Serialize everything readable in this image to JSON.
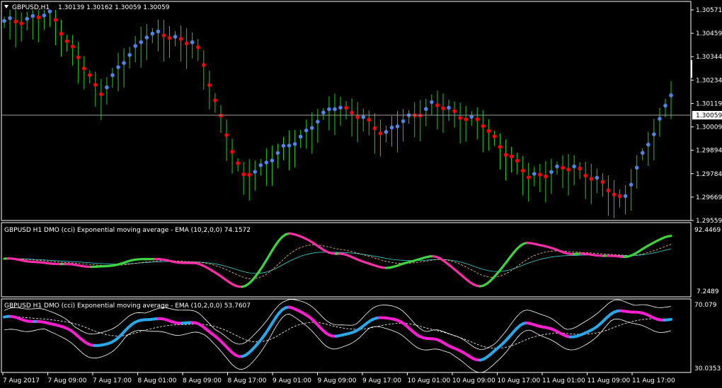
{
  "main": {
    "symbol_label": "GBPUSD,H1",
    "ohlc_label": "1.30139 1.30162 1.30059 1.30059",
    "price_ticks": [
      "1.30571",
      "1.30459",
      "1.30344",
      "1.30234",
      "1.30119",
      "1.30009",
      "1.29894",
      "1.29784",
      "1.29669",
      "1.29559"
    ],
    "current_price": "1.30059",
    "colors": {
      "bar": "#22cc22",
      "dot_up": "#4f86e6",
      "dot_down": "#ff0000",
      "price_line": "#a0a0a0"
    }
  },
  "sub1": {
    "title": "GBPUSD H1 DMO (cci) Exponential moving average - EMA (10,2,0,0) 74.1572",
    "axis_top": "92.4469",
    "axis_bottom": "7.2489",
    "colors": {
      "up": "#3fd43f",
      "down": "#ff2fa8",
      "signal": "#40d0d0",
      "ema": "#ffc080"
    }
  },
  "sub2": {
    "title": "GBPUSD H1 DMO (cci) Exponential moving average - EMA (10,2,0,0) 53.7607",
    "axis_top": "70.079",
    "axis_bottom": "30.0353",
    "colors": {
      "up": "#29a8e8",
      "down": "#ff1fcf",
      "band": "#ffffff"
    }
  },
  "time_axis": [
    "7 Aug 2017",
    "7 Aug 09:00",
    "7 Aug 17:00",
    "8 Aug 01:00",
    "8 Aug 09:00",
    "8 Aug 17:00",
    "9 Aug 01:00",
    "9 Aug 09:00",
    "9 Aug 17:00",
    "10 Aug 01:00",
    "10 Aug 09:00",
    "10 Aug 17:00",
    "11 Aug 01:00",
    "11 Aug 09:00",
    "11 Aug 17:00"
  ],
  "chart_data": [
    {
      "type": "line",
      "title": "GBPUSD,H1 1.30139 1.30162 1.30059 1.30059",
      "x": [
        "7 Aug 2017",
        "7 Aug 09:00",
        "7 Aug 17:00",
        "8 Aug 01:00",
        "8 Aug 09:00",
        "8 Aug 17:00",
        "9 Aug 01:00",
        "9 Aug 09:00",
        "9 Aug 17:00",
        "10 Aug 01:00",
        "10 Aug 09:00",
        "10 Aug 17:00",
        "11 Aug 01:00",
        "11 Aug 09:00",
        "11 Aug 17:00"
      ],
      "series": [
        {
          "name": "GBPUSD,H1",
          "values": [
            1.3051,
            1.3055,
            1.3017,
            1.3046,
            1.3042,
            1.2976,
            1.2992,
            1.3012,
            1.2998,
            1.3012,
            1.3003,
            1.2977,
            1.2982,
            1.2966,
            1.3017
          ]
        }
      ],
      "ylim": [
        1.29559,
        1.30571
      ]
    },
    {
      "type": "line",
      "title": "GBPUSD H1 DMO (cci) Exponential moving average - EMA (10,2,0,0) 74.1572",
      "x": [
        "7 Aug 2017",
        "7 Aug 09:00",
        "7 Aug 17:00",
        "8 Aug 01:00",
        "8 Aug 09:00",
        "8 Aug 17:00",
        "9 Aug 01:00",
        "9 Aug 09:00",
        "9 Aug 17:00",
        "10 Aug 01:00",
        "10 Aug 09:00",
        "10 Aug 17:00",
        "11 Aug 01:00",
        "11 Aug 09:00",
        "11 Aug 17:00"
      ],
      "series": [
        {
          "values": [
            55,
            48,
            43,
            55,
            48,
            14,
            92,
            62,
            42,
            58,
            15,
            78,
            62,
            58,
            88
          ]
        }
      ],
      "ylim": [
        7.2489,
        92.4469
      ]
    },
    {
      "type": "line",
      "title": "GBPUSD H1 DMO (cci) Exponential moving average - EMA (10,2,0,0) 53.7607",
      "x": [
        "7 Aug 2017",
        "7 Aug 09:00",
        "7 Aug 17:00",
        "8 Aug 01:00",
        "8 Aug 09:00",
        "8 Aug 17:00",
        "9 Aug 01:00",
        "9 Aug 09:00",
        "9 Aug 17:00",
        "10 Aug 01:00",
        "10 Aug 09:00",
        "10 Aug 17:00",
        "11 Aug 01:00",
        "11 Aug 09:00",
        "11 Aug 17:00"
      ],
      "series": [
        {
          "values": [
            62,
            58,
            44,
            61,
            58,
            38,
            68,
            50,
            62,
            48,
            36,
            58,
            50,
            66,
            60
          ]
        }
      ],
      "ylim": [
        30.0353,
        70.079
      ]
    }
  ]
}
